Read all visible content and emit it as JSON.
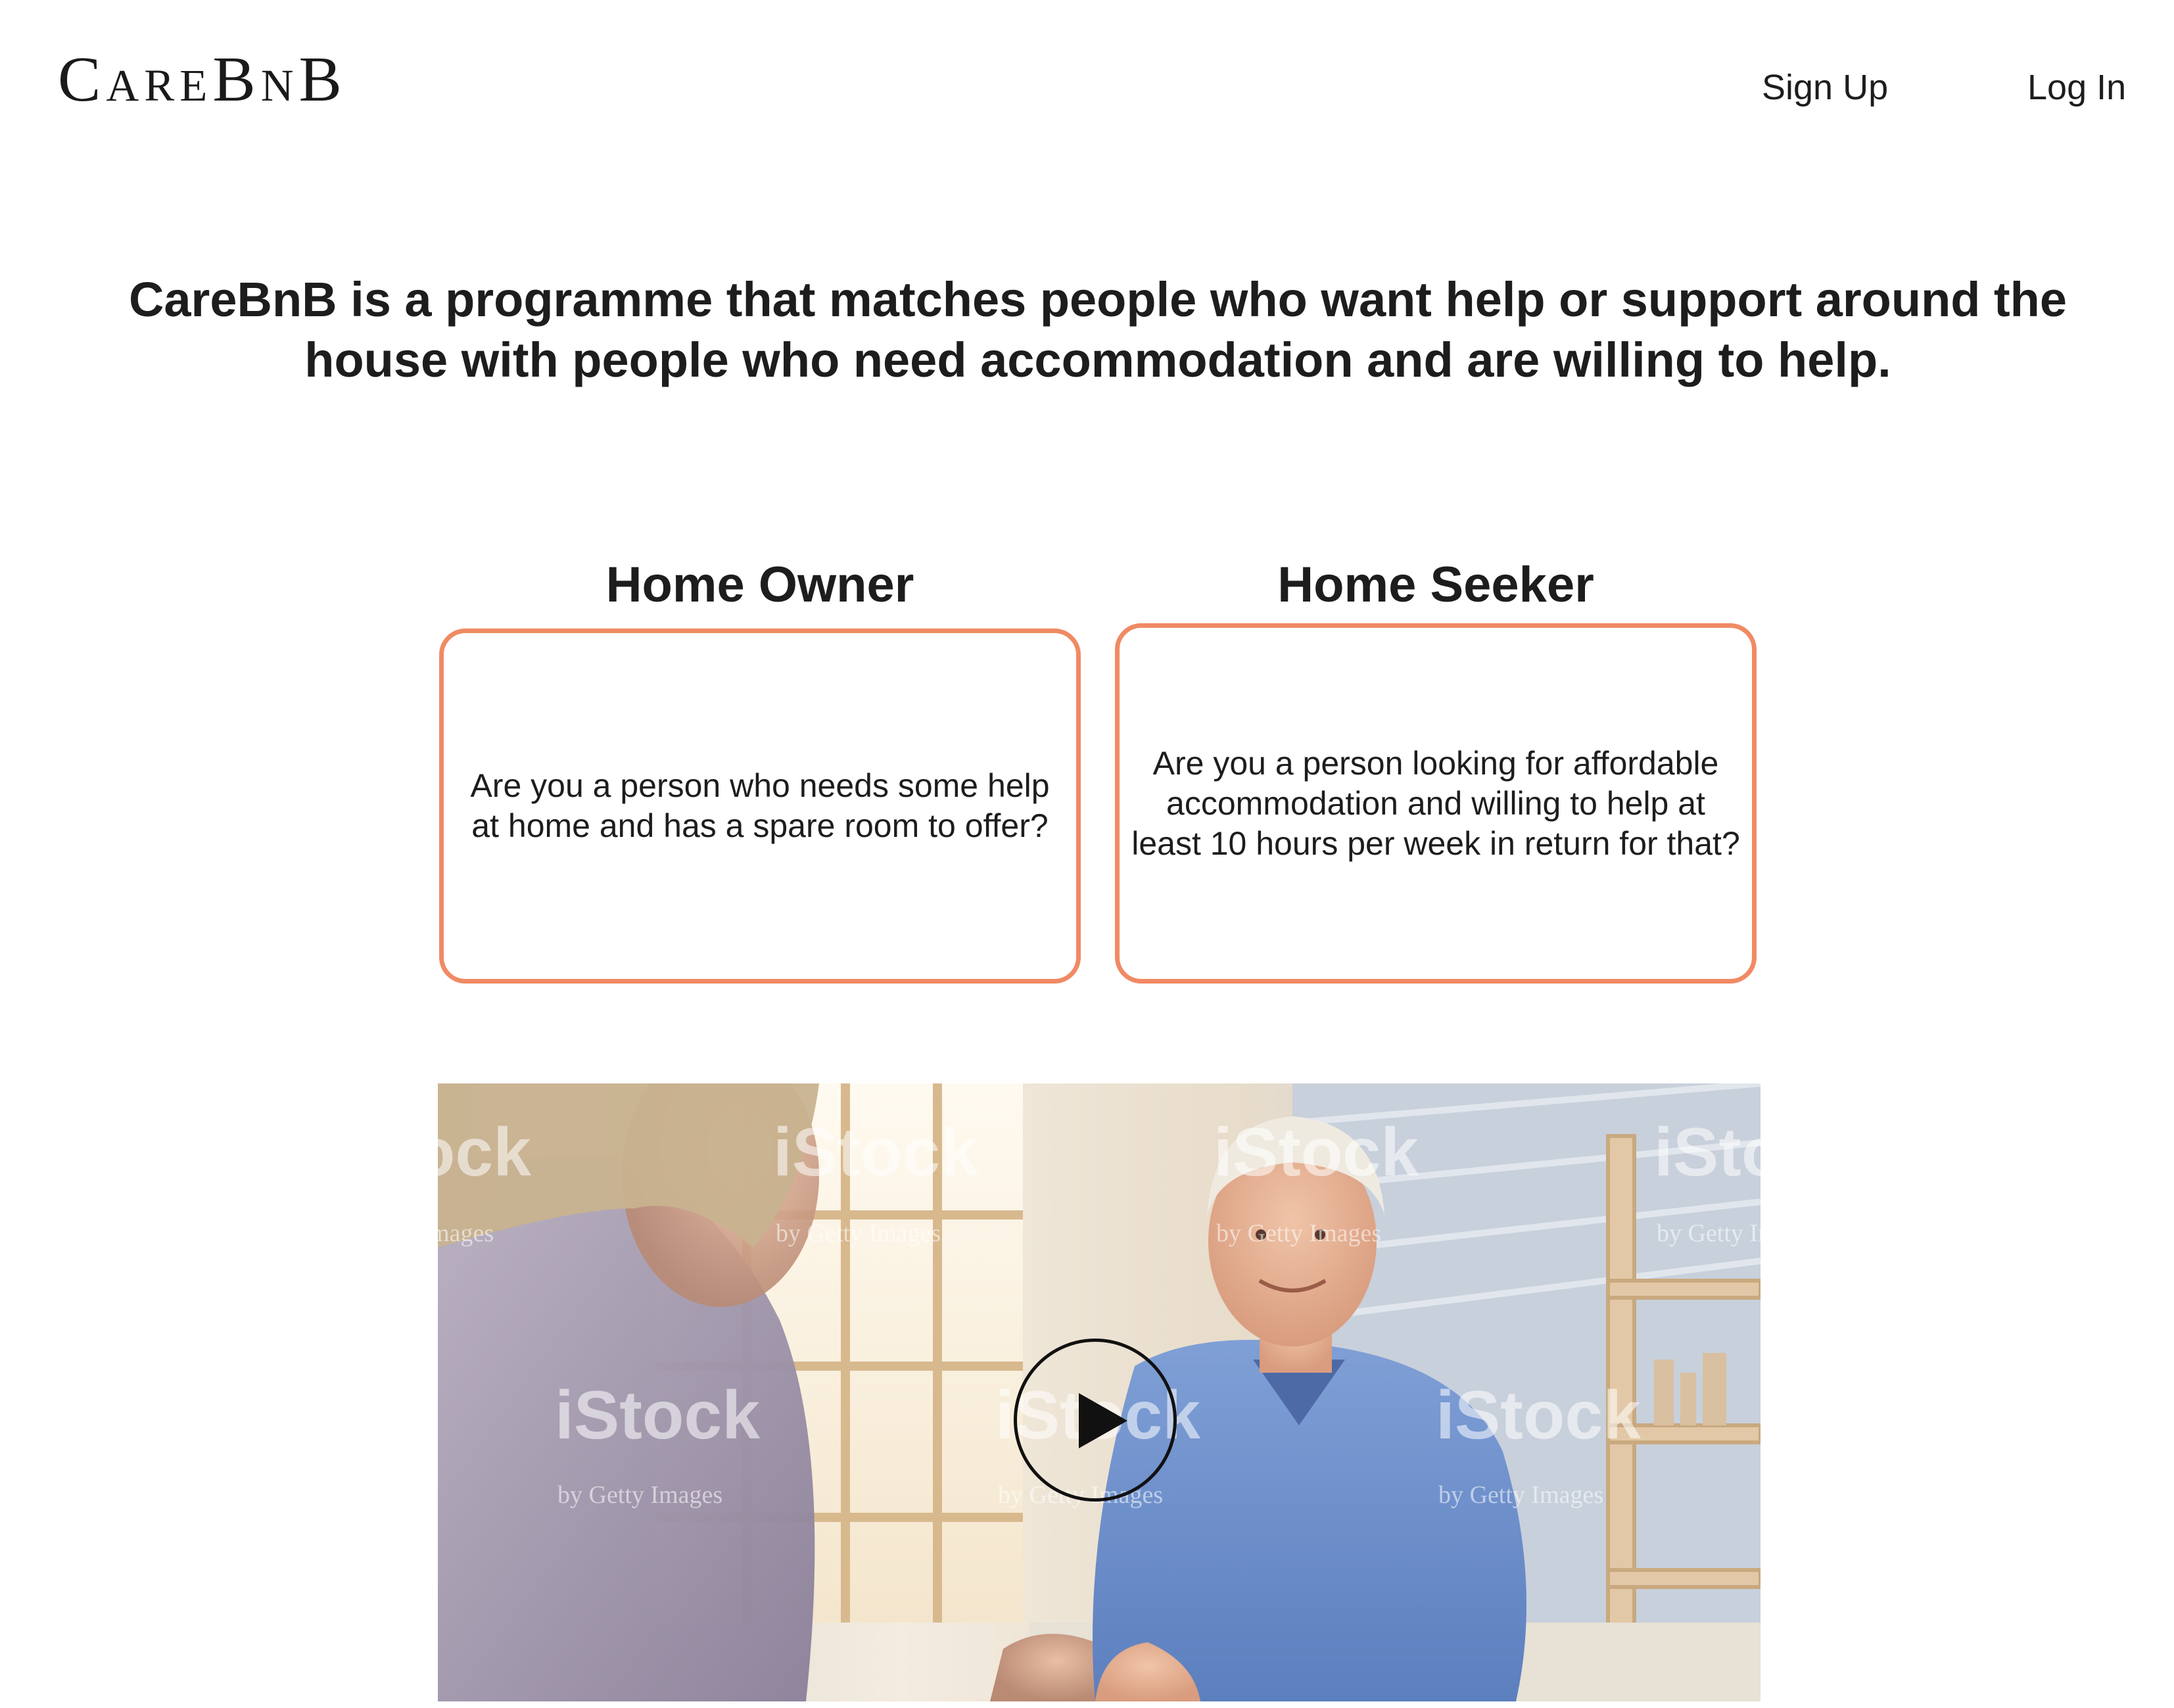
{
  "header": {
    "logo_text": "CareBnB",
    "nav": {
      "signup_label": "Sign Up",
      "login_label": "Log In"
    }
  },
  "intro": {
    "text": "CareBnB is a programme that matches people who want help or support around the house with people who need accommodation and are willing to help."
  },
  "roles": [
    {
      "title": "Home Owner",
      "description": "Are you a person who needs some help at home and has a spare room to offer?"
    },
    {
      "title": "Home Seeker",
      "description": "Are you a person looking for affordable accommodation and willing to help at least 10 hours per week in return for that?"
    }
  ],
  "video": {
    "play_icon": "play-icon",
    "watermark_main": "iStock",
    "watermark_sub": "by Getty Images"
  },
  "colors": {
    "accent_border": "#f08a64",
    "text": "#1d1d1d",
    "background": "#ffffff"
  }
}
